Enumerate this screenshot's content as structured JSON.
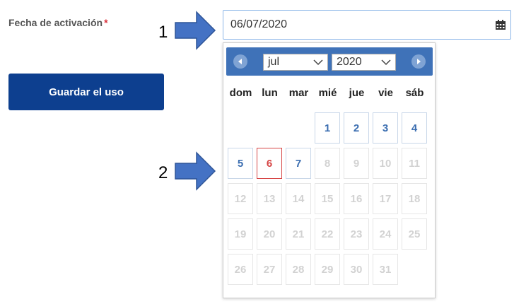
{
  "form": {
    "label": "Fecha de activación",
    "required_mark": "*",
    "save_label": "Guardar el uso"
  },
  "date_input": {
    "value": "06/07/2020",
    "icon": "calendar-icon"
  },
  "markers": {
    "one": "1",
    "two": "2"
  },
  "colors": {
    "accent": "#0d3f8f",
    "picker_header": "#3f72b8",
    "arrow": "#4472c4",
    "today_border": "#d64545",
    "required": "#d9303a"
  },
  "datepicker": {
    "prev_icon": "chevron-left-icon",
    "next_icon": "chevron-right-icon",
    "month": "jul",
    "year": "2020",
    "weekdays": [
      "dom",
      "lun",
      "mar",
      "mié",
      "jue",
      "vie",
      "sáb"
    ],
    "weeks": [
      [
        null,
        null,
        null,
        {
          "d": "1",
          "s": "active"
        },
        {
          "d": "2",
          "s": "active"
        },
        {
          "d": "3",
          "s": "active"
        },
        {
          "d": "4",
          "s": "active"
        }
      ],
      [
        {
          "d": "5",
          "s": "active"
        },
        {
          "d": "6",
          "s": "today"
        },
        {
          "d": "7",
          "s": "active"
        },
        {
          "d": "8",
          "s": "disabled"
        },
        {
          "d": "9",
          "s": "disabled"
        },
        {
          "d": "10",
          "s": "disabled"
        },
        {
          "d": "11",
          "s": "disabled"
        }
      ],
      [
        {
          "d": "12",
          "s": "disabled"
        },
        {
          "d": "13",
          "s": "disabled"
        },
        {
          "d": "14",
          "s": "disabled"
        },
        {
          "d": "15",
          "s": "disabled"
        },
        {
          "d": "16",
          "s": "disabled"
        },
        {
          "d": "17",
          "s": "disabled"
        },
        {
          "d": "18",
          "s": "disabled"
        }
      ],
      [
        {
          "d": "19",
          "s": "disabled"
        },
        {
          "d": "20",
          "s": "disabled"
        },
        {
          "d": "21",
          "s": "disabled"
        },
        {
          "d": "22",
          "s": "disabled"
        },
        {
          "d": "23",
          "s": "disabled"
        },
        {
          "d": "24",
          "s": "disabled"
        },
        {
          "d": "25",
          "s": "disabled"
        }
      ],
      [
        {
          "d": "26",
          "s": "disabled"
        },
        {
          "d": "27",
          "s": "disabled"
        },
        {
          "d": "28",
          "s": "disabled"
        },
        {
          "d": "29",
          "s": "disabled"
        },
        {
          "d": "30",
          "s": "disabled"
        },
        {
          "d": "31",
          "s": "disabled"
        },
        null
      ]
    ]
  }
}
